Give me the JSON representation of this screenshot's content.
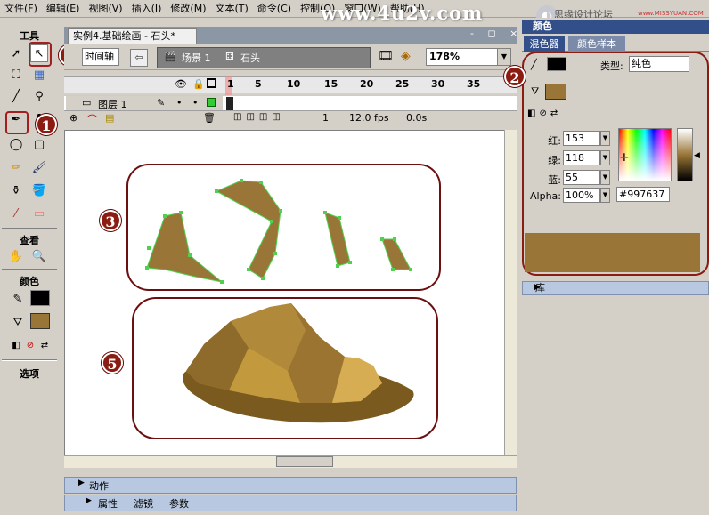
{
  "menubar": {
    "items": [
      "文件(F)",
      "编辑(E)",
      "视图(V)",
      "插入(I)",
      "修改(M)",
      "文本(T)",
      "命令(C)",
      "控制(O)",
      "窗口(W)",
      "帮助(H)"
    ]
  },
  "watermark": "www.4u2v.com",
  "logo": {
    "tagline": "思缘设计论坛",
    "url": "www.MISSYUAN.COM",
    "big": "思缘"
  },
  "tools": {
    "heading": "工具",
    "view_heading": "查看",
    "colors_heading": "颜色",
    "options_heading": "选项"
  },
  "document": {
    "tab_title": "实例4.基础绘画 - 石头*",
    "window_buttons": "- ◻ ×",
    "timeline_button": "时间轴",
    "scene_label": "场景 1",
    "symbol_label": "石头",
    "zoom": "178%"
  },
  "timeline": {
    "layer_name": "图层 1",
    "frame_numbers": [
      "1",
      "5",
      "10",
      "15",
      "20",
      "25",
      "30",
      "35"
    ],
    "current_frame": "1",
    "fps": "12.0 fps",
    "elapsed": "0.0s"
  },
  "panels": {
    "actions": "动作",
    "properties": "属性",
    "filters": "滤镜",
    "params": "参数"
  },
  "color_panel": {
    "title": "颜色",
    "tab_mixer": "混色器",
    "tab_swatches": "颜色样本",
    "type_label": "类型:",
    "type_value": "纯色",
    "red_label": "红:",
    "red": "153",
    "green_label": "绿:",
    "green": "118",
    "blue_label": "蓝:",
    "blue": "55",
    "alpha_label": "Alpha:",
    "alpha": "100%",
    "hex": "#997637",
    "fill_color": "#997637"
  },
  "library": {
    "title": "库"
  },
  "badges": [
    "1",
    "2",
    "3",
    "4",
    "5"
  ],
  "colors": {
    "stone": "#997637",
    "stone_dark": "#7a5a1e",
    "outline": "#6b0f0f",
    "accent": "#334f8a"
  }
}
